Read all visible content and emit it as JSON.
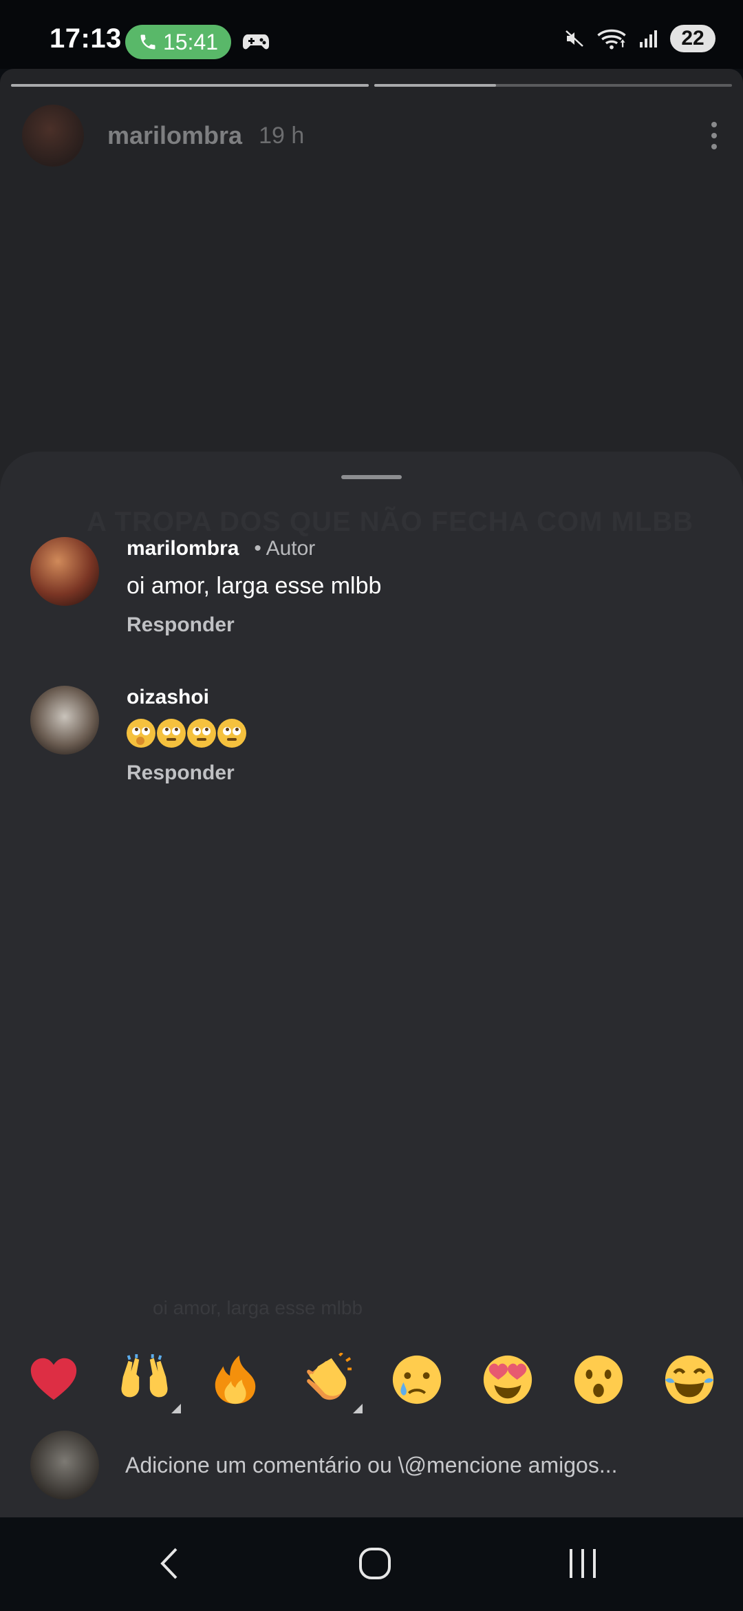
{
  "status_bar": {
    "time": "17:13",
    "call_timer": "15:41",
    "battery": "22"
  },
  "story": {
    "username": "marilombra",
    "time_ago": "19 h",
    "progress": [
      1.0,
      0.34
    ]
  },
  "sheet": {
    "ghost_title": "A TROPA DOS QUE NÃO FECHA COM MLBB",
    "ghost_caption": "oi amor, larga esse mlbb",
    "comments": [
      {
        "username": "marilombra",
        "badge": "• Autor",
        "text": "oi amor, larga esse mlbb",
        "reply_label": "Responder"
      },
      {
        "username": "oizashoi",
        "text": "",
        "emojis": [
          "shushing-face",
          "eye-roll-face",
          "eye-roll-face",
          "eye-roll-face"
        ],
        "reply_label": "Responder"
      }
    ]
  },
  "reactions": [
    "red-heart",
    "raising-hands",
    "fire",
    "clapping-hands",
    "crying-face",
    "heart-eyes-face",
    "surprised-face",
    "tears-of-joy-face"
  ],
  "input": {
    "placeholder": "Adicione um comentário ou \\@mencione amigos..."
  },
  "colors": {
    "call_pill": "#59b869",
    "sheet": "#2a2b2f",
    "story_bg": "#232427"
  }
}
